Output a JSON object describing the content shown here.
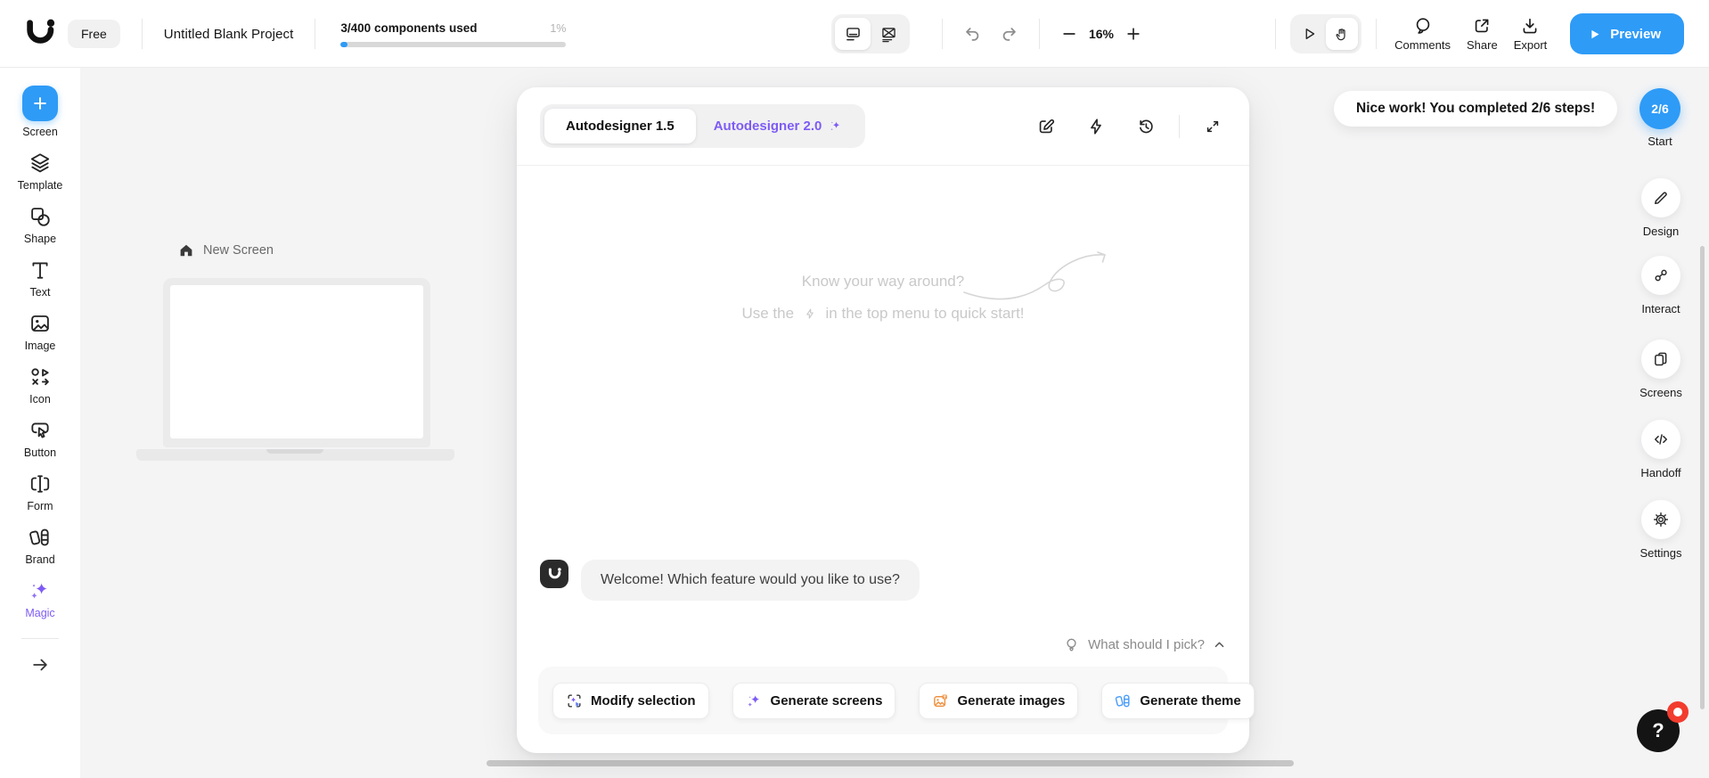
{
  "topbar": {
    "free_badge": "Free",
    "project_title": "Untitled Blank Project",
    "components_used": "3/400 components used",
    "components_percent": "1%",
    "zoom_level": "16%",
    "comments_label": "Comments",
    "share_label": "Share",
    "export_label": "Export",
    "preview_label": "Preview"
  },
  "sidebar": {
    "items": [
      {
        "label": "Screen",
        "icon": "plus-icon"
      },
      {
        "label": "Template",
        "icon": "layers-icon"
      },
      {
        "label": "Shape",
        "icon": "shapes-icon"
      },
      {
        "label": "Text",
        "icon": "text-icon"
      },
      {
        "label": "Image",
        "icon": "image-icon"
      },
      {
        "label": "Icon",
        "icon": "glyph-set-icon"
      },
      {
        "label": "Button",
        "icon": "button-cursor-icon"
      },
      {
        "label": "Form",
        "icon": "form-field-icon"
      },
      {
        "label": "Brand",
        "icon": "brand-cards-icon"
      },
      {
        "label": "Magic",
        "icon": "sparkles-icon"
      }
    ]
  },
  "canvas": {
    "screen_label": "New Screen"
  },
  "assistant": {
    "tabs": [
      {
        "label": "Autodesigner 1.5"
      },
      {
        "label": "Autodesigner 2.0"
      }
    ],
    "hint_line1": "Know your way around?",
    "hint_line2_prefix": "Use the",
    "hint_line2_suffix": "in the top menu to quick start!",
    "message": "Welcome! Which feature would you like to use?",
    "prompt": "What should I pick?",
    "actions": [
      {
        "label": "Modify selection",
        "icon": "modify-selection-icon"
      },
      {
        "label": "Generate screens",
        "icon": "sparkle-icon"
      },
      {
        "label": "Generate images",
        "icon": "image-generate-icon"
      },
      {
        "label": "Generate theme",
        "icon": "theme-icon"
      }
    ]
  },
  "right_panel": {
    "tooltip": "Nice work! You completed 2/6 steps!",
    "progress_badge": "2/6",
    "items": [
      {
        "label": "Start"
      },
      {
        "label": "Design"
      },
      {
        "label": "Interact"
      },
      {
        "label": "Screens"
      },
      {
        "label": "Handoff"
      },
      {
        "label": "Settings"
      }
    ]
  },
  "help_button": {
    "label": "?"
  },
  "colors": {
    "accent_blue": "#2E9BF7",
    "magic_purple": "#7E5BF5",
    "image_orange": "#EF9141",
    "theme_blue": "#4A9DF8",
    "alert_red": "#F23C2E"
  }
}
